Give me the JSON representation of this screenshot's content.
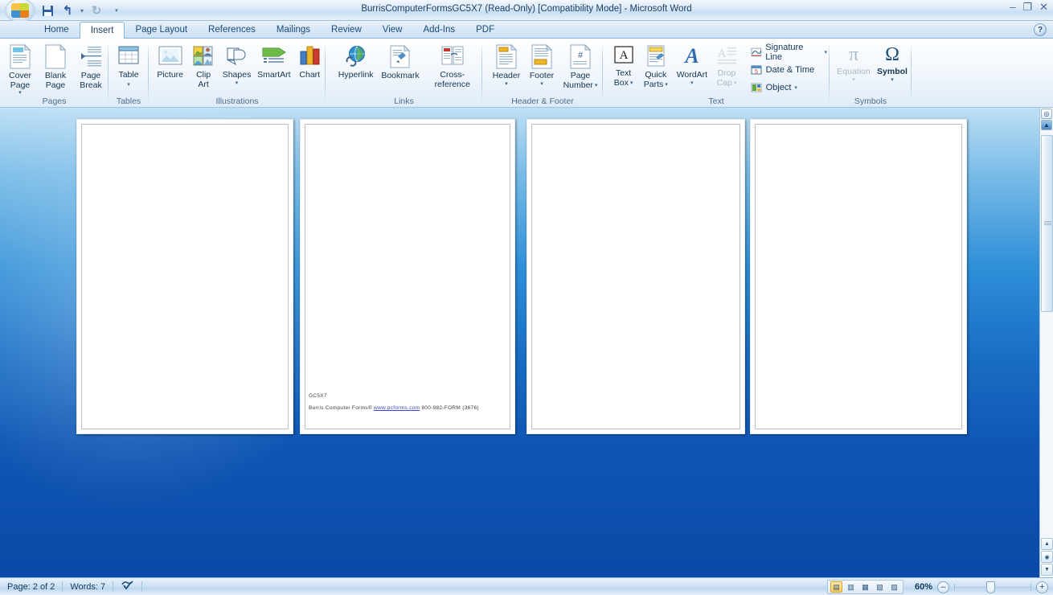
{
  "window": {
    "title": "BurrisComputerFormsGC5X7 (Read-Only) [Compatibility Mode] - Microsoft Word",
    "minimize": "–",
    "maximize": "❐",
    "close": "✕"
  },
  "quick_access": {
    "office_button": "office-orb",
    "save": "Save",
    "undo": "Undo",
    "undo_caret": "▾",
    "redo": "Redo",
    "customize": "▾"
  },
  "help": {
    "label": "?"
  },
  "tabs": [
    {
      "label": "Home",
      "active": false
    },
    {
      "label": "Insert",
      "active": true
    },
    {
      "label": "Page Layout",
      "active": false
    },
    {
      "label": "References",
      "active": false
    },
    {
      "label": "Mailings",
      "active": false
    },
    {
      "label": "Review",
      "active": false
    },
    {
      "label": "View",
      "active": false
    },
    {
      "label": "Add-Ins",
      "active": false
    },
    {
      "label": "PDF",
      "active": false
    }
  ],
  "ribbon": {
    "groups": [
      {
        "name": "Pages",
        "label": "Pages",
        "buttons": [
          {
            "label": "Cover\nPage",
            "line1": "Cover",
            "line2": "Page",
            "caret": "▾",
            "disabled": false
          },
          {
            "label": "Blank\nPage",
            "line1": "Blank",
            "line2": "Page",
            "caret": "",
            "disabled": false
          },
          {
            "label": "Page\nBreak",
            "line1": "Page",
            "line2": "Break",
            "caret": "",
            "disabled": false
          }
        ]
      },
      {
        "name": "Tables",
        "label": "Tables",
        "buttons": [
          {
            "line1": "Table",
            "line2": "",
            "caret": "▾",
            "disabled": false
          }
        ]
      },
      {
        "name": "Illustrations",
        "label": "Illustrations",
        "buttons": [
          {
            "line1": "Picture",
            "line2": "",
            "caret": "",
            "disabled": false
          },
          {
            "line1": "Clip",
            "line2": "Art",
            "caret": "",
            "disabled": false
          },
          {
            "line1": "Shapes",
            "line2": "",
            "caret": "▾",
            "disabled": false
          },
          {
            "line1": "SmartArt",
            "line2": "",
            "caret": "",
            "disabled": false
          },
          {
            "line1": "Chart",
            "line2": "",
            "caret": "",
            "disabled": false
          }
        ]
      },
      {
        "name": "Links",
        "label": "Links",
        "buttons": [
          {
            "line1": "Hyperlink",
            "line2": "",
            "caret": "",
            "disabled": false
          },
          {
            "line1": "Bookmark",
            "line2": "",
            "caret": "",
            "disabled": false
          },
          {
            "line1": "Cross-reference",
            "line2": "",
            "caret": "",
            "disabled": false
          }
        ]
      },
      {
        "name": "Header & Footer",
        "label": "Header & Footer",
        "buttons": [
          {
            "line1": "Header",
            "line2": "",
            "caret": "▾",
            "disabled": false
          },
          {
            "line1": "Footer",
            "line2": "",
            "caret": "▾",
            "disabled": false
          },
          {
            "line1": "Page",
            "line2": "Number",
            "caret": "▾",
            "disabled": false
          }
        ]
      },
      {
        "name": "Text",
        "label": "Text",
        "buttons": [
          {
            "line1": "Text",
            "line2": "Box",
            "caret": "▾",
            "disabled": false
          },
          {
            "line1": "Quick",
            "line2": "Parts",
            "caret": "▾",
            "disabled": false
          },
          {
            "line1": "WordArt",
            "line2": "",
            "caret": "▾",
            "disabled": false
          },
          {
            "line1": "Drop",
            "line2": "Cap",
            "caret": "▾",
            "disabled": true
          }
        ],
        "small_buttons": [
          {
            "label": "Signature Line",
            "caret": "▾"
          },
          {
            "label": "Date & Time",
            "caret": ""
          },
          {
            "label": "Object",
            "caret": "▾"
          }
        ]
      },
      {
        "name": "Symbols",
        "label": "Symbols",
        "buttons": [
          {
            "line1": "Equation",
            "line2": "",
            "caret": "▾",
            "disabled": true,
            "glyph": "π"
          },
          {
            "line1": "Symbol",
            "line2": "",
            "caret": "▾",
            "disabled": false,
            "glyph": "Ω"
          }
        ]
      }
    ]
  },
  "document": {
    "pages": [
      {
        "index": 1,
        "content": ""
      },
      {
        "index": 2,
        "footer_line1": "GC5X7",
        "footer_prefix": "Burris Computer Forms® ",
        "footer_link": "www.pcforms.com",
        "footer_suffix": " 800-982-FORM (3676)"
      },
      {
        "index": 3,
        "content": ""
      },
      {
        "index": 4,
        "content": ""
      }
    ]
  },
  "scrollbar": {
    "top_icons": [
      "select-browse-object",
      "previous-page"
    ],
    "up_arrow": "▲",
    "down_arrow": "▼",
    "prev_page": "▲",
    "next_page": "▼"
  },
  "statusbar": {
    "page": "Page: 2 of 2",
    "words": "Words: 7",
    "proofing": "proofing-errors-icon",
    "view_buttons": [
      {
        "name": "print-layout",
        "glyph": "▤",
        "selected": true
      },
      {
        "name": "full-screen-reading",
        "glyph": "▥",
        "selected": false
      },
      {
        "name": "web-layout",
        "glyph": "▦",
        "selected": false
      },
      {
        "name": "outline",
        "glyph": "▧",
        "selected": false
      },
      {
        "name": "draft",
        "glyph": "▨",
        "selected": false
      }
    ],
    "zoom_level": "60%",
    "zoom_out": "–",
    "zoom_in": "+"
  }
}
